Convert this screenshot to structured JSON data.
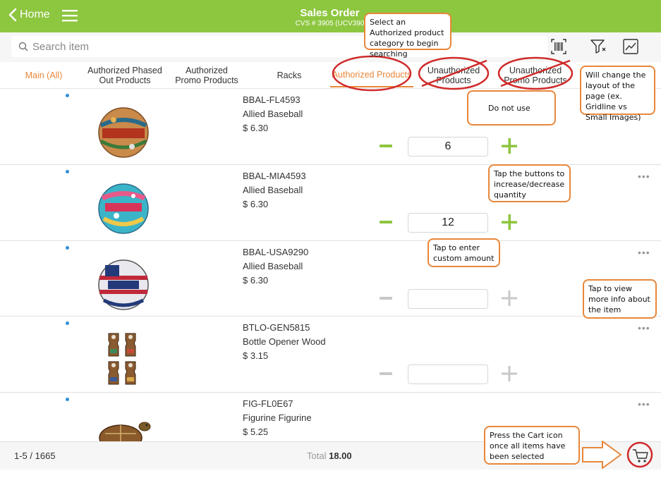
{
  "header": {
    "back_label": "Home",
    "title": "Sales Order",
    "subtitle": "CVS # 3905 (UCV390"
  },
  "search": {
    "placeholder": "Search item"
  },
  "tabs": [
    {
      "label": "Main (All)"
    },
    {
      "label": "Authorized Phased Out Products"
    },
    {
      "label": "Authorized Promo Products"
    },
    {
      "label": "Racks"
    },
    {
      "label": "Authorized Products"
    },
    {
      "label": "Unauthorized Products"
    },
    {
      "label": "Unauthorized Promo Products"
    }
  ],
  "products": [
    {
      "sku": "BBAL-FL4593",
      "name": "Allied Baseball",
      "price": "$ 6.30",
      "qty": "6",
      "image": "florida-baseball"
    },
    {
      "sku": "BBAL-MIA4593",
      "name": "Allied Baseball",
      "price": "$ 6.30",
      "qty": "12",
      "image": "miami-baseball"
    },
    {
      "sku": "BBAL-USA9290",
      "name": "Allied Baseball",
      "price": "$ 6.30",
      "qty": "",
      "image": "usa-baseball"
    },
    {
      "sku": "BTLO-GEN5815",
      "name": "Bottle Opener Wood",
      "price": "$ 3.15",
      "qty": "",
      "image": "bottle-openers"
    },
    {
      "sku": "FIG-FL0E67",
      "name": "Figurine Figurine",
      "price": "$ 5.25",
      "qty": "",
      "image": "turtle-figurine"
    }
  ],
  "footer": {
    "count": "1-5 / 1665",
    "total_label": "Total",
    "total_value": "18.00"
  },
  "annotations": {
    "category": "Select an Authorized product category to begin searching",
    "layout": "Will change the layout of the page (ex. Gridline vs Small Images)",
    "do_not_use": "Do not use",
    "qty_buttons": "Tap the buttons to increase/decrease quantity",
    "custom": "Tap to enter custom amount",
    "more_info": "Tap to view more info about the item",
    "cart": "Press the Cart icon once all items have been selected"
  },
  "icons": [
    "chevron-left-icon",
    "hamburger-icon",
    "search-icon",
    "barcode-icon",
    "filter-icon",
    "chart-icon",
    "cart-icon",
    "more-icon"
  ],
  "colors": {
    "brand_green": "#8dc63f",
    "accent_orange": "#e8873a",
    "cross_red": "#d02a2a",
    "dot_blue": "#2f8fd6",
    "disabled_gray": "#c8c8c8"
  }
}
